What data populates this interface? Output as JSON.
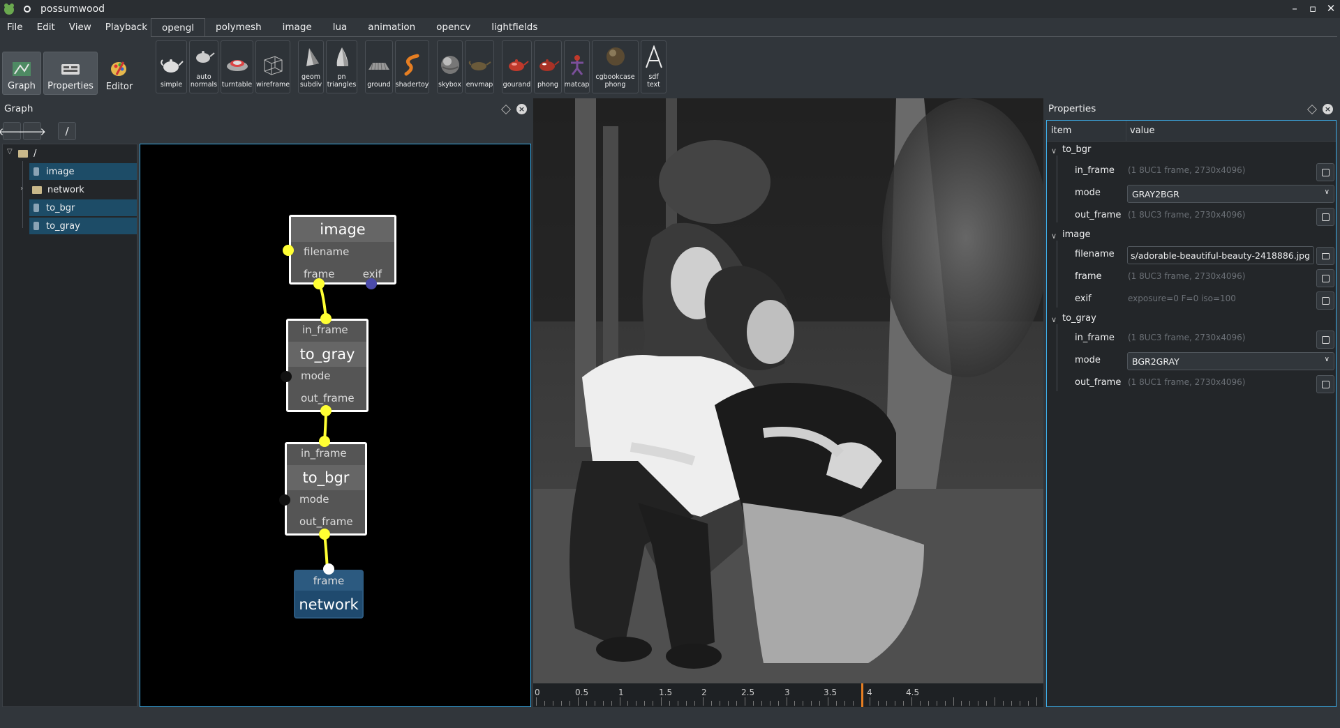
{
  "app": {
    "title": "possumwood"
  },
  "window_buttons": {
    "minimize": "–",
    "maximize": "▫",
    "close": "✕"
  },
  "menu": [
    "File",
    "Edit",
    "View",
    "Playback"
  ],
  "main_buttons": [
    {
      "label": "Graph",
      "icon": "graph-icon",
      "active": true
    },
    {
      "label": "Properties",
      "icon": "properties-icon",
      "active": true
    },
    {
      "label": "Editor",
      "icon": "editor-icon",
      "active": false
    }
  ],
  "tabs": [
    "opengl",
    "polymesh",
    "image",
    "lua",
    "animation",
    "opencv",
    "lightfields"
  ],
  "active_tab": "opengl",
  "tools": [
    {
      "label": "simple",
      "icon": "teapot-icon"
    },
    {
      "label": "auto\nnormals",
      "icon": "teapot-icon"
    },
    {
      "label": "turntable",
      "icon": "car-icon"
    },
    {
      "label": "wireframe",
      "icon": "cube-wireframe-icon"
    },
    {
      "label": "geom\nsubdiv",
      "icon": "shape-icon"
    },
    {
      "label": "pn\ntriangles",
      "icon": "cone-icon"
    },
    {
      "label": "ground",
      "icon": "ground-icon"
    },
    {
      "label": "shadertoy",
      "icon": "shadertoy-icon"
    },
    {
      "label": "skybox",
      "icon": "sphere-icon"
    },
    {
      "label": "envmap",
      "icon": "teapot-icon"
    },
    {
      "label": "gourand",
      "icon": "teapot-red-icon"
    },
    {
      "label": "phong",
      "icon": "teapot-red-icon"
    },
    {
      "label": "matcap",
      "icon": "figure-icon"
    },
    {
      "label": "cgbookcase\nphong",
      "icon": "sphere-icon"
    },
    {
      "label": "sdf\ntext",
      "icon": "letter-a-icon"
    }
  ],
  "graph_dock": {
    "title": "Graph",
    "nav_back": "🡐",
    "nav_forward": "🡒",
    "path": "/",
    "tree": {
      "root": "/",
      "items": [
        {
          "label": "image",
          "type": "node",
          "selected": true
        },
        {
          "label": "network",
          "type": "folder",
          "selected": false
        },
        {
          "label": "to_bgr",
          "type": "node",
          "selected": true
        },
        {
          "label": "to_gray",
          "type": "node",
          "selected": true
        }
      ]
    }
  },
  "nodes": {
    "image": {
      "title": "image",
      "ports": [
        "filename",
        "frame",
        "exif"
      ]
    },
    "to_gray": {
      "title": "to_gray",
      "ports": [
        "in_frame",
        "mode",
        "out_frame"
      ]
    },
    "to_bgr": {
      "title": "to_bgr",
      "ports": [
        "in_frame",
        "mode",
        "out_frame"
      ]
    },
    "network": {
      "title": "network",
      "ports": [
        "frame"
      ]
    }
  },
  "timeline": {
    "labels": [
      "0",
      "0.5",
      "1",
      "1.5",
      "2",
      "2.5",
      "3",
      "3.5",
      "4",
      "4.5"
    ],
    "current": 3.9
  },
  "properties": {
    "title": "Properties",
    "col_item": "item",
    "col_value": "value",
    "groups": [
      {
        "name": "to_bgr",
        "rows": [
          {
            "key": "in_frame",
            "value": "(1 8UC1 frame, 2730x4096)",
            "kind": "readonly"
          },
          {
            "key": "mode",
            "value": "GRAY2BGR",
            "kind": "combo"
          },
          {
            "key": "out_frame",
            "value": "(1 8UC3 frame, 2730x4096)",
            "kind": "readonly"
          }
        ]
      },
      {
        "name": "image",
        "rows": [
          {
            "key": "filename",
            "value": "s/adorable-beautiful-beauty-2418886.jpg",
            "kind": "file"
          },
          {
            "key": "frame",
            "value": "(1 8UC3 frame, 2730x4096)",
            "kind": "readonly"
          },
          {
            "key": "exif",
            "value": "exposure=0  F=0  iso=100",
            "kind": "readonly"
          }
        ]
      },
      {
        "name": "to_gray",
        "rows": [
          {
            "key": "in_frame",
            "value": "(1 8UC3 frame, 2730x4096)",
            "kind": "readonly"
          },
          {
            "key": "mode",
            "value": "BGR2GRAY",
            "kind": "combo"
          },
          {
            "key": "out_frame",
            "value": "(1 8UC1 frame, 2730x4096)",
            "kind": "readonly"
          }
        ]
      }
    ]
  },
  "colors": {
    "accent": "#3daee9",
    "selection": "#1d4c67",
    "port_yellow": "#ffff33",
    "timeline_cursor": "#e67e22"
  }
}
